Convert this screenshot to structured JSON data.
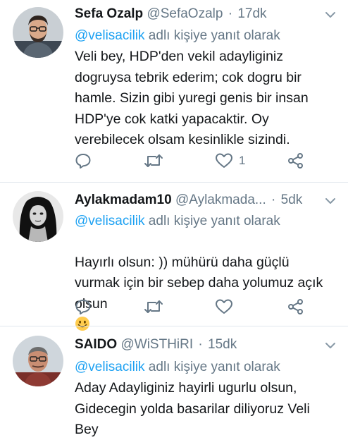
{
  "tweets": [
    {
      "name": "Sefa Ozalp",
      "handle": "@SefaOzalp",
      "time": "17dk",
      "reply_prefix_mention": "@velisacilik",
      "reply_suffix": " adlı kişiye yanıt olarak",
      "text": "Veli bey, HDP'den vekil adayliginiz\ndogruysa tebrik ederim; cok dogru bir\nhamle. Sizin gibi yuregi genis bir insan\nHDP'ye cok katki yapacaktir. Oy\nverebilecek olsam kesinlikle sizindi.",
      "like_count": "1",
      "avatar_icon": "profile-photo-man-glasses-beard"
    },
    {
      "name": "Aylakmadam10",
      "handle": "@Aylakmada...",
      "time": "5dk",
      "reply_prefix_mention": "@velisacilik",
      "reply_suffix": " adlı kişiye yanıt olarak",
      "text": "Hayırlı olsun: )) mühürü daha güçlü\nvurmak için bir sebep daha yolumuz açık\nolsun",
      "like_count": "",
      "avatar_icon": "profile-photo-woman-bw"
    },
    {
      "name": "SAIDO",
      "handle": "@WiSTHiRI",
      "time": "15dk",
      "reply_prefix_mention": "@velisacilik",
      "reply_suffix": " adlı kişiye yanıt olarak",
      "text": "Aday Adayliginiz hayirli ugurlu olsun,\nGidecegin yolda basarilar diliyoruz Veli\nBey",
      "like_count": "",
      "avatar_icon": "profile-photo-man-glasses-grey"
    }
  ],
  "separator": "·",
  "icons": {
    "reply": "reply-icon",
    "retweet": "retweet-icon",
    "like": "heart-icon",
    "share": "share-icon",
    "caret": "chevron-down-icon",
    "emoji": "smiling-face-emoji"
  },
  "colors": {
    "link": "#1da1f2",
    "secondary_text": "#657786",
    "icon": "#657786",
    "divider": "#e1e8ed"
  }
}
